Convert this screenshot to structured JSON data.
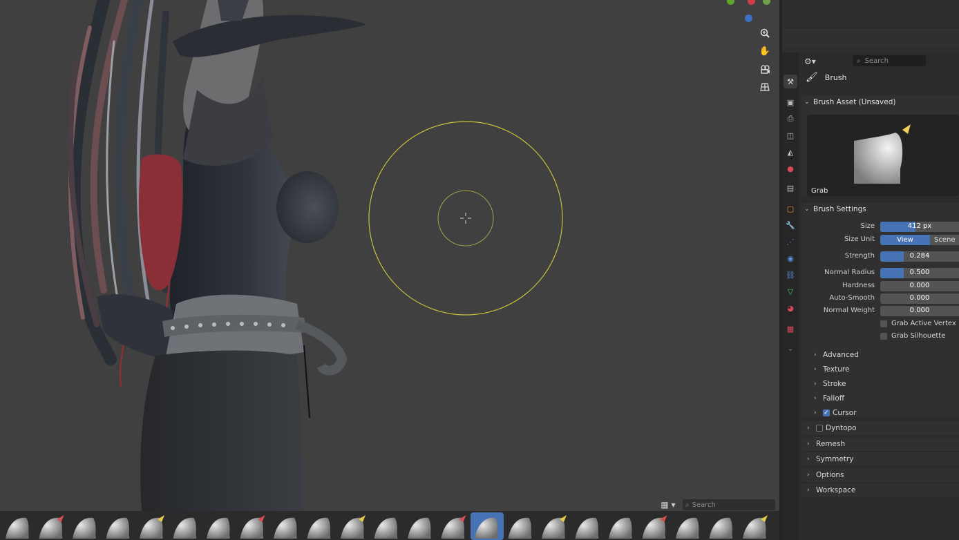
{
  "viewport": {
    "search_placeholder": "Search",
    "grid_icon": "grid-icon",
    "nav_icons": [
      "zoom-icon",
      "hand-pan-icon",
      "camera-view-icon",
      "perspective-grid-icon"
    ]
  },
  "properties": {
    "search_placeholder": "Search",
    "context_label": "Brush",
    "brush_asset": {
      "title": "Brush Asset (Unsaved)",
      "preview_label": "Grab"
    },
    "brush_settings": {
      "title": "Brush Settings",
      "size": {
        "label": "Size",
        "value": "412 px",
        "fill": 0.45
      },
      "size_unit": {
        "label": "Size Unit",
        "option_on": "View",
        "option_off": "Scene"
      },
      "strength": {
        "label": "Strength",
        "value": "0.284",
        "fill": 0.3
      },
      "normal_radius": {
        "label": "Normal Radius",
        "value": "0.500",
        "fill": 0.3
      },
      "hardness": {
        "label": "Hardness",
        "value": "0.000"
      },
      "auto_smooth": {
        "label": "Auto-Smooth",
        "value": "0.000"
      },
      "normal_weight": {
        "label": "Normal Weight",
        "value": "0.000"
      },
      "grab_active_vertex": {
        "label": "Grab Active Vertex",
        "checked": false
      },
      "grab_silhouette": {
        "label": "Grab Silhouette",
        "checked": false
      }
    },
    "subpanels": [
      "Advanced",
      "Texture",
      "Stroke",
      "Falloff"
    ],
    "cursor": {
      "label": "Cursor",
      "checked": true
    },
    "dyntopo": {
      "label": "Dyntopo",
      "checked": false
    },
    "panels": [
      "Remesh",
      "Symmetry",
      "Options",
      "Workspace"
    ]
  },
  "colors": {
    "accent": "#4772b3",
    "brush_circle": "#c8c23a"
  }
}
